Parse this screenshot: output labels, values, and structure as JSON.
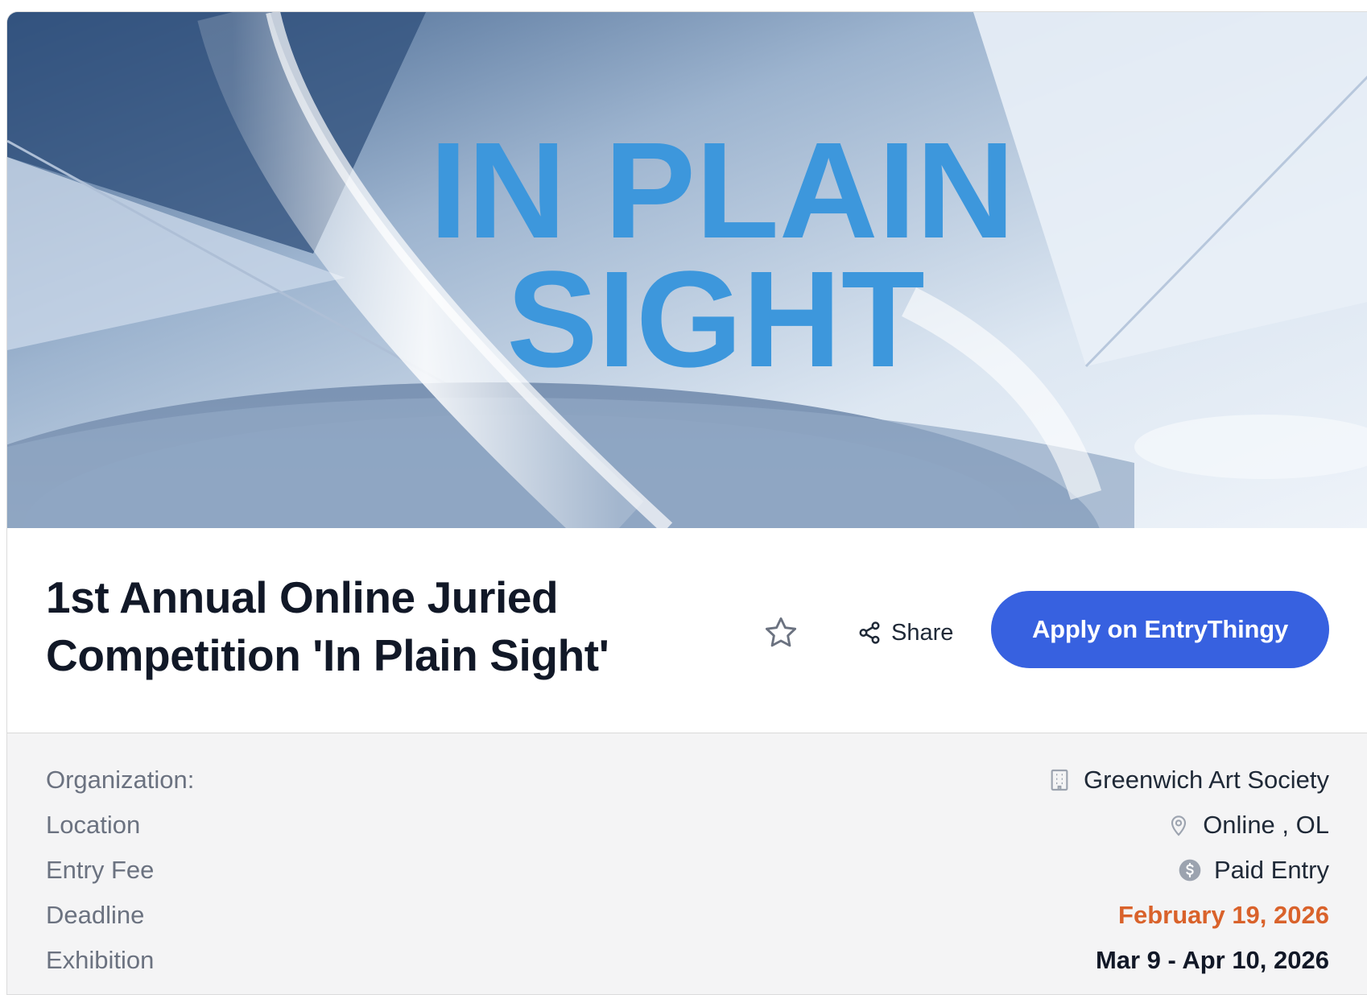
{
  "hero": {
    "banner_line1": "IN PLAIN",
    "banner_line2": "SIGHT"
  },
  "header": {
    "title": "1st Annual Online Juried Competition 'In Plain Sight'",
    "share_label": "Share",
    "apply_label": "Apply on EntryThingy"
  },
  "details": {
    "organization": {
      "label": "Organization:",
      "value": "Greenwich Art Society",
      "icon": "building-icon"
    },
    "location": {
      "label": "Location",
      "value": "Online , OL",
      "icon": "map-pin-icon"
    },
    "entry_fee": {
      "label": "Entry Fee",
      "value": "Paid Entry",
      "icon": "dollar-circle-icon"
    },
    "deadline": {
      "label": "Deadline",
      "value": "February 19, 2026"
    },
    "exhibition": {
      "label": "Exhibition",
      "value": "Mar 9 - Apr 10, 2026"
    }
  },
  "colors": {
    "accent": "#3761e0",
    "deadline": "#d9622b",
    "banner_text": "#3d97dc"
  }
}
